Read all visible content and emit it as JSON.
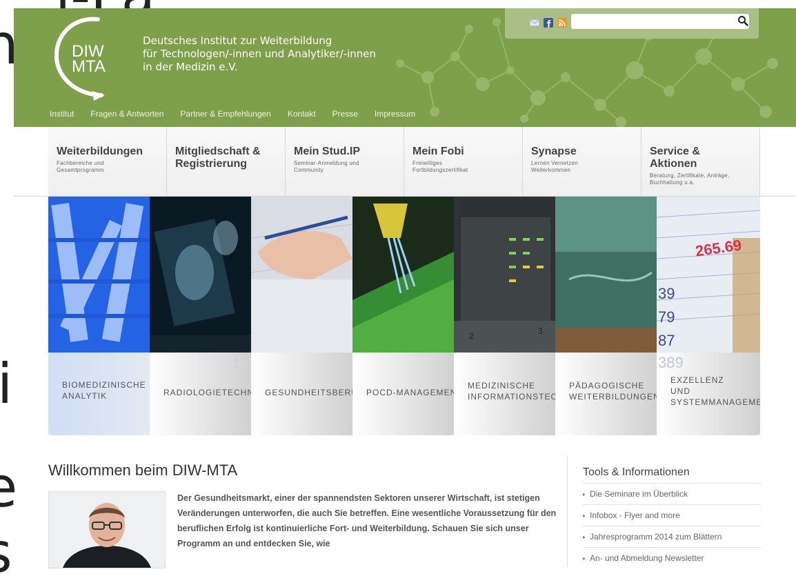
{
  "org": {
    "logo_text_1": "DIW",
    "logo_text_2": "MTA",
    "name_lines": [
      "Deutsches Institut zur Weiterbildung",
      "für Technologen/-innen und Analytiker/-innen",
      "in der Medizin e.V."
    ]
  },
  "topnav": [
    "Institut",
    "Fragen & Antworten",
    "Partner & Empfehlungen",
    "Kontakt",
    "Presse",
    "Impressum"
  ],
  "util": {
    "icons": [
      "mail-icon",
      "facebook-icon",
      "rss-icon"
    ],
    "search_value": ""
  },
  "mainnav": [
    {
      "title": "Weiterbildungen",
      "sub": "Fachbereiche und Gesamtprogramm"
    },
    {
      "title": "Mitgliedschaft & Registrierung",
      "sub": ""
    },
    {
      "title": "Mein Stud.IP",
      "sub": "Seminar-Anmeldung und Community"
    },
    {
      "title": "Mein Fobi",
      "sub": "Freiwilliges Fortbildungszertifikat"
    },
    {
      "title": "Synapse",
      "sub": "Lernen Vernetzen Weiterkommen"
    },
    {
      "title": "Service & Aktionen",
      "sub": "Beratung, Zertifikate, Anträge, Buchhaltung u.a."
    }
  ],
  "tiles": [
    {
      "lines": [
        "BIOMEDIZINISCHE",
        "ANALYTIK"
      ]
    },
    {
      "lines": [
        "RADIOLOGIETECHNIK"
      ]
    },
    {
      "lines": [
        "GESUNDHEITSBERUFE"
      ]
    },
    {
      "lines": [
        "POCD-MANAGEMENT"
      ]
    },
    {
      "lines": [
        "MEDIZINISCHE",
        "INFORMATIONSTECHNIK"
      ]
    },
    {
      "lines": [
        "PÄDAGOGISCHE",
        "WEITERBILDUNGEN"
      ]
    },
    {
      "lines": [
        "EXZELLENZ",
        "UND",
        "SYSTEMMANAGEMENT"
      ]
    }
  ],
  "tile_printed_text": {
    "number_1": "1",
    "number_2": "2",
    "number_3": "3",
    "fig_1": "265.69",
    "fig_2": "39",
    "fig_3": "79",
    "fig_4": "87",
    "fig_5": "389"
  },
  "welcome": {
    "title": "Willkommen beim DIW-MTA",
    "text": "Der Gesundheitsmarkt, einer der spannendsten Sektoren unserer Wirtschaft, ist stetigen Veränderungen unterworfen, die auch Sie betreffen. Eine wesentliche Voraussetzung für den beruflichen Erfolg ist kontinuierliche Fort- und Weiterbildung. Schauen Sie sich unser Programm an und entdecken Sie, wie"
  },
  "tools": {
    "title": "Tools & Informationen",
    "items": [
      "Die Seminare im Überblick",
      "Infobox - Flyer and more",
      "Jahresprogramm 2014 zum Blättern",
      "An- und Abmeldung Newsletter"
    ]
  },
  "edge_text": {
    "top": "i-Pa",
    "right_1": "n",
    "right_2": "i",
    "right_3": "e",
    "right_4": "s"
  }
}
